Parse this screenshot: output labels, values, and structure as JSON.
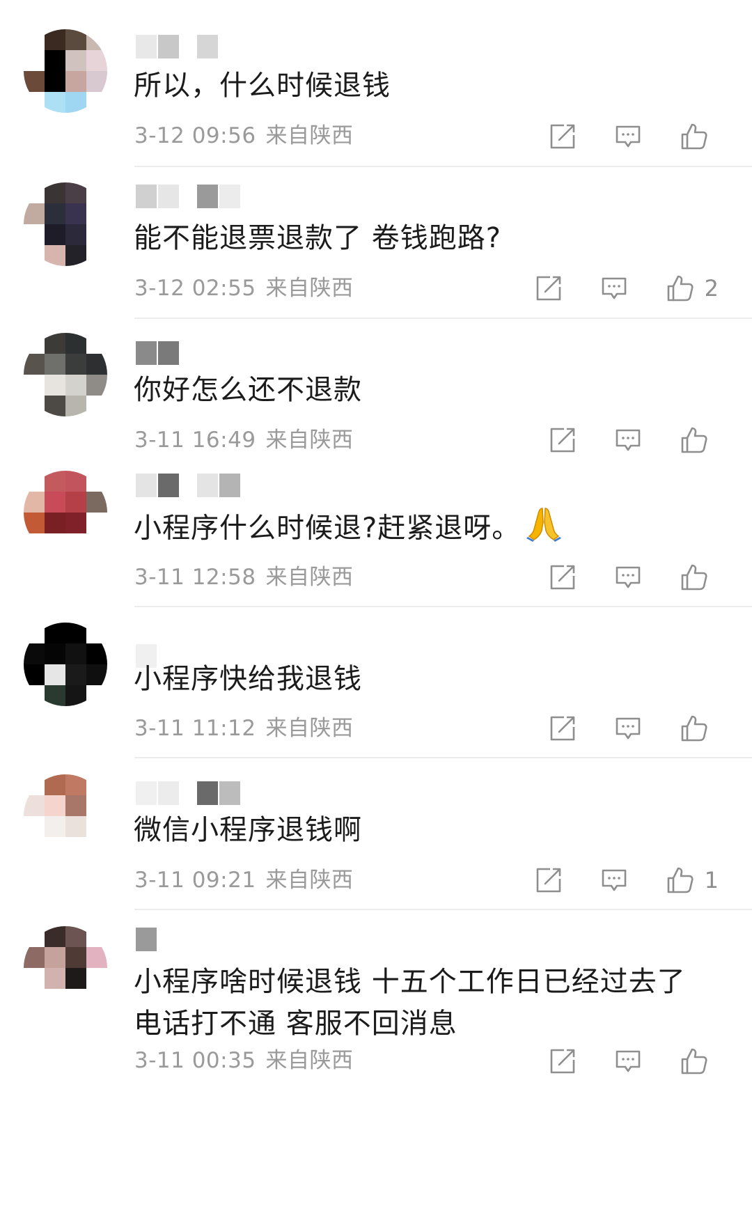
{
  "comments": [
    {
      "text": "所以，什么时候退钱",
      "date": "3-12 09:56",
      "location": "来自陕西",
      "likes": "",
      "avatar_colors": [
        "#ffffff",
        "#3a2a22",
        "#5b4a3e",
        "#c8b8b0",
        "#ffffff",
        "#000000",
        "#d0c2bf",
        "#e6d4d8",
        "#6b4a3a",
        "#000000",
        "#c7a6a0",
        "#d8c9d0",
        "#ffffff",
        "#aee0f5",
        "#9fd6f2",
        "#ffffff"
      ],
      "name_blocks": [
        "#e8e8e8",
        "#c8c8c8",
        "#d6d6d6"
      ]
    },
    {
      "text": "能不能退票退款了 卷钱跑路?",
      "date": "3-12 02:55",
      "location": "来自陕西",
      "likes": "2",
      "avatar_colors": [
        "#ffffff",
        "#3b3434",
        "#4a3f46",
        "#ffffff",
        "#c1aaa0",
        "#2d2e3c",
        "#3a3350",
        "#ffffff",
        "#ffffff",
        "#1d1c28",
        "#2c2a3a",
        "#ffffff",
        "#ffffff",
        "#d8b4ae",
        "#222228",
        "#ffffff"
      ],
      "name_blocks": [
        "#d0d0d0",
        "#e6e6e6",
        "#9a9a9a",
        "#ececec"
      ]
    },
    {
      "text": "你好怎么还不退款",
      "date": "3-11 16:49",
      "location": "来自陕西",
      "likes": "",
      "avatar_colors": [
        "#ffffff",
        "#3c3b38",
        "#2d3030",
        "#ffffff",
        "#59534e",
        "#6f6f6b",
        "#3b3d3d",
        "#2d2f30",
        "#ffffff",
        "#e7e4df",
        "#d4d2cc",
        "#8f8c87",
        "#ffffff",
        "#4d4a46",
        "#b8b5ae",
        "#ffffff"
      ],
      "name_blocks": [
        "#8a8a8a",
        "#7a7a7a"
      ]
    },
    {
      "text": "小程序什么时候退?赶紧退呀。",
      "date": "3-11 12:58",
      "location": "来自陕西",
      "likes": "",
      "emoji": "pray",
      "avatar_colors": [
        "#ffffff",
        "#c35a5e",
        "#c2545d",
        "#ffffff",
        "#e3b7a5",
        "#c94a58",
        "#b54048",
        "#7a6a60",
        "#c25a36",
        "#7a1f24",
        "#80212a",
        "#ffffff",
        "#ffffff",
        "#ffffff",
        "#ffffff",
        "#ffffff"
      ],
      "name_blocks": [
        "#e4e4e4",
        "#6a6a6a",
        "#e4e4e4",
        "#b4b4b4"
      ]
    },
    {
      "text": "小程序快给我退钱",
      "date": "3-11 11:12",
      "location": "来自陕西",
      "likes": "",
      "avatar_colors": [
        "#ffffff",
        "#000000",
        "#000000",
        "#ffffff",
        "#0a0a0a",
        "#050505",
        "#111111",
        "#000000",
        "#000000",
        "#e6e6e6",
        "#1a1a1a",
        "#0f0f0f",
        "#ffffff",
        "#2a3a30",
        "#151515",
        "#ffffff"
      ],
      "name_blocks": [
        "#f0f0f0"
      ]
    },
    {
      "text": "微信小程序退钱啊",
      "date": "3-11 09:21",
      "location": "来自陕西",
      "likes": "1",
      "avatar_colors": [
        "#ffffff",
        "#b06a52",
        "#c07962",
        "#ffffff",
        "#ede0dc",
        "#f4d4cc",
        "#a9766a",
        "#ffffff",
        "#ffffff",
        "#f2efec",
        "#eae0dc",
        "#ffffff",
        "#ffffff",
        "#ffffff",
        "#ffffff",
        "#ffffff"
      ],
      "name_blocks": [
        "#f0f0f0",
        "#ececec",
        "#6a6a6a",
        "#bcbcbc"
      ]
    },
    {
      "text": "小程序啥时候退钱 十五个工作日已经过去了\n电话打不通 客服不回消息",
      "date": "3-11 00:35",
      "location": "来自陕西",
      "likes": "",
      "avatar_colors": [
        "#ffffff",
        "#3a2c28",
        "#6b5452",
        "#ffffff",
        "#8d6a63",
        "#c6a29c",
        "#503a36",
        "#e2b2c0",
        "#ffffff",
        "#d2b2ae",
        "#1e1a1a",
        "#ffffff",
        "#ffffff",
        "#ffffff",
        "#ffffff",
        "#ffffff"
      ],
      "name_blocks": [
        "#9a9a9a"
      ]
    }
  ]
}
